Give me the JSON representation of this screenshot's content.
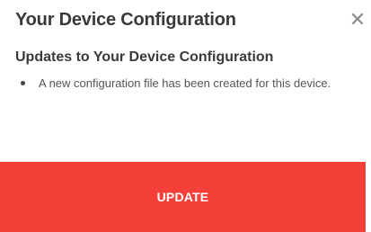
{
  "dialog": {
    "title": "Your Device Configuration",
    "close_icon": "close-icon",
    "close_glyph": "✕",
    "section_heading": "Updates to Your Device Configuration",
    "messages": [
      "A new configuration file has been created for this device."
    ],
    "update_label": "UPDATE"
  },
  "colors": {
    "accent": "#f5403a",
    "text": "#3a3a3a",
    "muted": "#8c8c8c"
  }
}
